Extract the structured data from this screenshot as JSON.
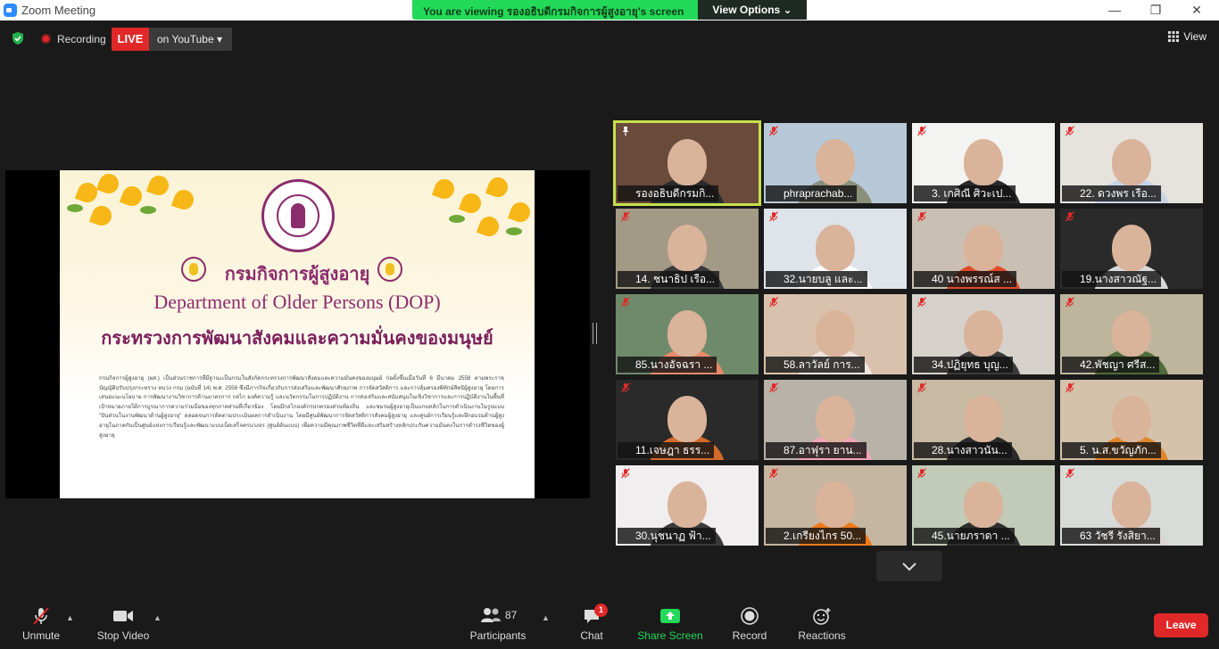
{
  "window": {
    "title": "Zoom Meeting",
    "minimize": "—",
    "restore": "❐",
    "close": "✕"
  },
  "banner": {
    "message": "You are viewing รองอธิบดีกรมกิจการผู้สูงอายุ's screen",
    "view_options": "View Options ⌄"
  },
  "status": {
    "recording": "Recording",
    "live": "LIVE",
    "youtube": "on YouTube ▾",
    "view": "View"
  },
  "slide": {
    "title_th": "กรมกิจการผู้สูงอายุ",
    "title_en": "Department of Older Persons (DOP)",
    "ministry_th": "กระทรวงการพัฒนาสังคมและความมั่นคงของมนุษย์",
    "body": "กรมกิจการผู้สูงอายุ (ผส.) เป็นส่วนราชการที่มีฐานะเป็นกรมในสังกัดกระทรวงการพัฒนาสังคมและความมั่นคงของมนุษย์ ก่อตั้งขึ้นเมื่อวันที่ 6 มีนาคม 2558 ตามพระราชบัญญัติปรับปรุงกระทรวง ทบวง กรม (ฉบับที่ 14) พ.ศ. 2558 ซึ่งมีภารกิจเกี่ยวกับการส่งเสริมและพัฒนาศักยภาพ การจัดสวัสดิการ และการคุ้มครองพิทักษ์สิทธิผู้สูงอายุ โดยการเสนอแนะนโยบาย การพัฒนางานวิชาการด้านมาตรการ กลไก องค์ความรู้ และนวัตกรรมในการปฏิบัติงาน การส่งเสริมและสนับสนุนในเชิงวิชาการและการปฏิบัติงานในพื้นที่เป้าหมายภายใต้การบูรณาการความร่วมมือของทุกภาคส่วนที่เกี่ยวข้อง โดยมีกลไกองค์กรปกครองส่วนท้องถิ่น และชมรมผู้สูงอายุเป็นแกนหลักในการดำเนินงานในรูปแบบ \"ปันส่วนในงานพัฒนาด้านผู้สูงอายุ\" ตลอดจนการติดตามประเมินผลการดำเนินงาน โดยมีศูนย์พัฒนาการจัดสวัสดิการสังคมผู้สูงอายุ และศูนย์การเรียนรู้และฝึกอบรมด้านผู้สูงอายุในภาคกับเป็นศูนย์แห่งการเรียนรู้และพัฒนาแบบเบ็ดเสร็จครบวงจร (ศูนย์ต้นแบบ) เพื่อความมีคุณภาพชีวิตที่ดีและเสริมสร้างหลักประกันความมั่นคงในการดำรงชีวิตของผู้สูงอายุ"
  },
  "participants": [
    {
      "name": "รองอธิบดีกรมกิ...",
      "pinned": true,
      "bg": "#6a4a3a",
      "body": "#2b2b2b",
      "active": true
    },
    {
      "name": "phraprachab...",
      "bg": "#b7c9d8",
      "body": "#8a8f7a"
    },
    {
      "name": "3. เกศิณี ศิวะเป...",
      "bg": "#f3f3f1",
      "body": "#2a2a2a"
    },
    {
      "name": "22. ดวงพร เรือ...",
      "bg": "#e6e2dc",
      "body": "#c7d4e6"
    },
    {
      "name": "14. ชนาธิป เรือ...",
      "bg": "#a39a86",
      "body": "#3a3a3a"
    },
    {
      "name": "32.นายบลู และ...",
      "bg": "#dfe4ea",
      "body": "#ffffff"
    },
    {
      "name": "40 นางพรรณ์ส ...",
      "bg": "#c9c0b3",
      "body": "#e04b2a"
    },
    {
      "name": "19.นางสาวณัฐ...",
      "bg": "#2a2a2a",
      "body": "#d8d8d8"
    },
    {
      "name": "85.นางอัจฉรา ...",
      "bg": "#6f8a6b",
      "body": "#e88a6a"
    },
    {
      "name": "58.ลาวัลย์ การ...",
      "bg": "#d9c2ad",
      "body": "#f1e6df"
    },
    {
      "name": "34.ปฏิยุทธ บุญ...",
      "bg": "#d6d2cb",
      "body": "#3b3b3b"
    },
    {
      "name": "42.พัชญา ศรีส...",
      "bg": "#bdb59c",
      "body": "#4f6b3a"
    },
    {
      "name": "11.เจษฎา ธรร...",
      "bg": "#2a2a2a",
      "body": "#d46b2a"
    },
    {
      "name": "87.อาฟุรา  ยาน...",
      "bg": "#b9b2a8",
      "body": "#f2a5b6"
    },
    {
      "name": "28.นางสาวนัน...",
      "bg": "#c8b9a3",
      "body": "#2b2b2b"
    },
    {
      "name": "5. น.ส.ขวัญภัก...",
      "bg": "#d4c2ab",
      "body": "#e0862a"
    },
    {
      "name": "30.นุชนาฏ ฟ้า...",
      "bg": "#f0eeee",
      "body": "#3a3a3a"
    },
    {
      "name": "2.เกรียงไกร 50...",
      "bg": "#c6b5a0",
      "body": "#f07a1a"
    },
    {
      "name": "45.นายภราดา ...",
      "bg": "#c2cbb8",
      "body": "#2f2f2f"
    },
    {
      "name": "63 วัชรี รังสิยา...",
      "bg": "#d8dcd8",
      "body": "#dcd5d3"
    }
  ],
  "toolbar": {
    "unmute": "Unmute",
    "stop_video": "Stop Video",
    "participants_count": "87",
    "participants": "Participants",
    "chat": "Chat",
    "chat_badge": "1",
    "share_screen": "Share Screen",
    "record": "Record",
    "reactions": "Reactions",
    "leave": "Leave"
  }
}
